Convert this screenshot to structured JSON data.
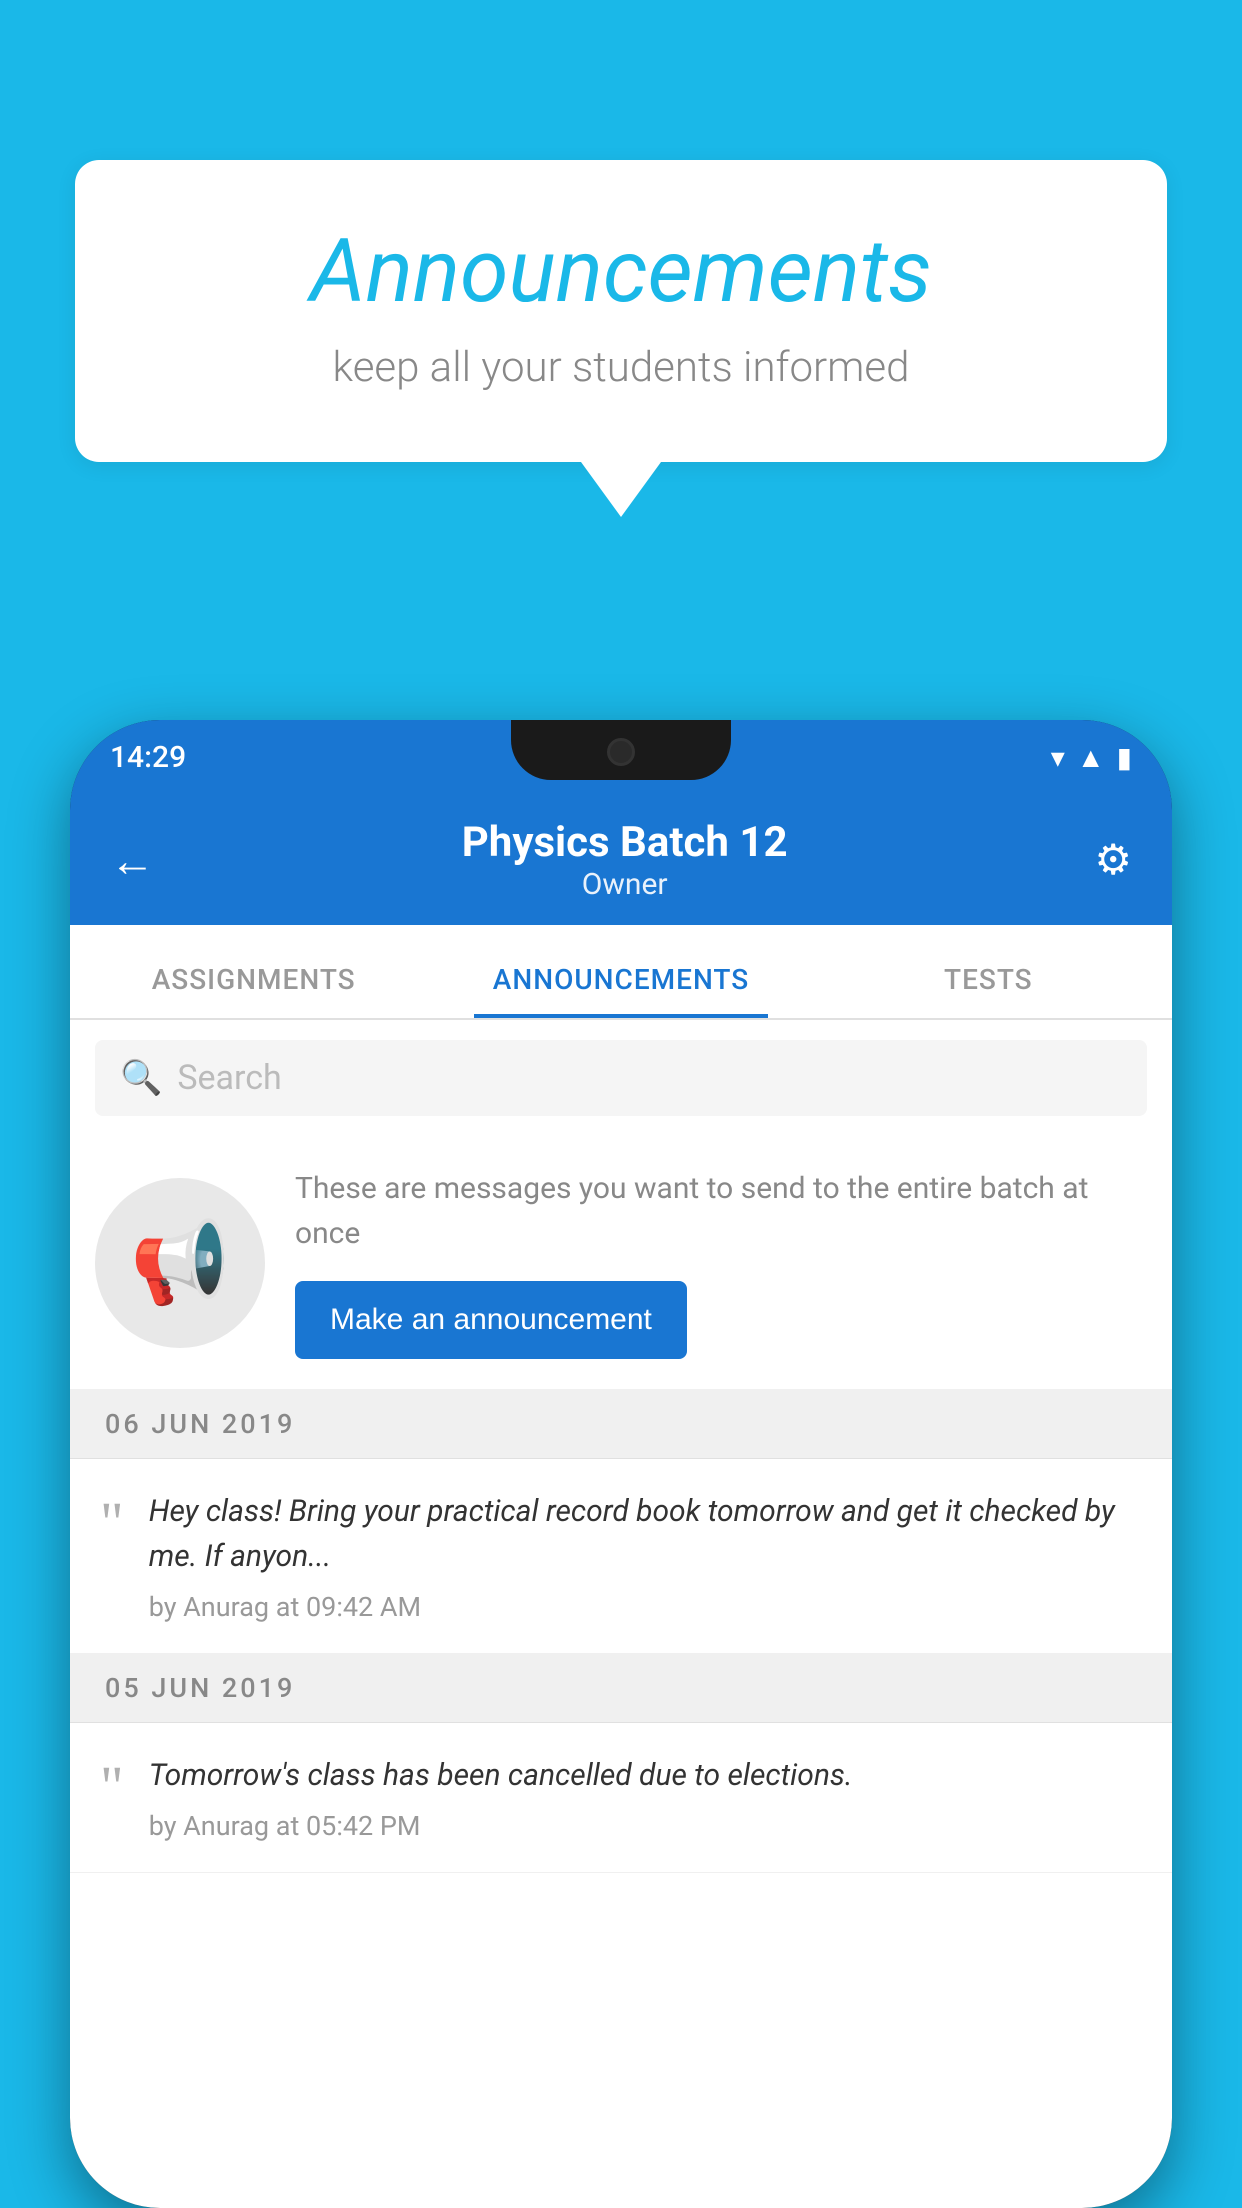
{
  "background_color": "#1ab8e8",
  "speech_bubble": {
    "title": "Announcements",
    "subtitle": "keep all your students informed"
  },
  "phone": {
    "status_bar": {
      "time": "14:29",
      "icons": [
        "wifi",
        "signal",
        "battery"
      ]
    },
    "app_bar": {
      "title": "Physics Batch 12",
      "subtitle": "Owner",
      "back_label": "←",
      "settings_label": "⚙"
    },
    "tabs": [
      {
        "label": "ASSIGNMENTS",
        "active": false
      },
      {
        "label": "ANNOUNCEMENTS",
        "active": true
      },
      {
        "label": "TESTS",
        "active": false
      }
    ],
    "search": {
      "placeholder": "Search"
    },
    "empty_state": {
      "description": "These are messages you want to send to the entire batch at once",
      "button_label": "Make an announcement"
    },
    "announcements": [
      {
        "date": "06  JUN  2019",
        "text": "Hey class! Bring your practical record book tomorrow and get it checked by me. If anyon...",
        "meta": "by Anurag at 09:42 AM"
      },
      {
        "date": "05  JUN  2019",
        "text": "Tomorrow's class has been cancelled due to elections.",
        "meta": "by Anurag at 05:42 PM"
      }
    ]
  }
}
